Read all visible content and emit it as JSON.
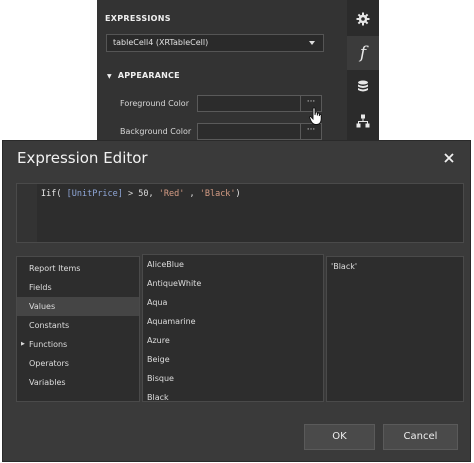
{
  "panel": {
    "expressions_heading": "EXPRESSIONS",
    "target_select": "tableCell4 (XRTableCell)",
    "section_title": "APPEARANCE",
    "foreground_label": "Foreground Color",
    "background_label": "Background Color",
    "ellipsis": "···"
  },
  "side_tabs": [
    {
      "icon": "gear-icon"
    },
    {
      "icon": "function-icon",
      "glyph": "f"
    },
    {
      "icon": "database-icon"
    },
    {
      "icon": "hierarchy-icon"
    }
  ],
  "dialog": {
    "title": "Expression Editor",
    "expression": {
      "fn": "Iif(",
      "field": "[UnitPrice]",
      "op": "> 50,",
      "str1": "'Red'",
      "comma": ",",
      "str2": "'Black'",
      "close": ")"
    },
    "categories": [
      {
        "label": "Report Items"
      },
      {
        "label": "Fields"
      },
      {
        "label": "Values",
        "selected": true
      },
      {
        "label": "Constants"
      },
      {
        "label": "Functions",
        "has_children": true
      },
      {
        "label": "Operators"
      },
      {
        "label": "Variables"
      }
    ],
    "values": [
      "AliceBlue",
      "AntiqueWhite",
      "Aqua",
      "Aquamarine",
      "Azure",
      "Beige",
      "Bisque",
      "Black"
    ],
    "description": "'Black'",
    "ok_label": "OK",
    "cancel_label": "Cancel"
  },
  "colors": {
    "panel_bg": "#333333",
    "dialog_bg": "#3a3a3a",
    "list_bg": "#2d2d2d",
    "selected_bg": "#454545"
  }
}
